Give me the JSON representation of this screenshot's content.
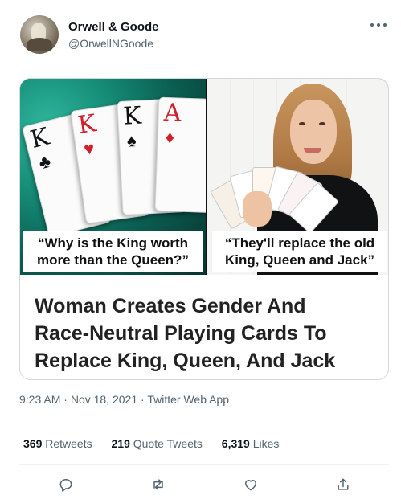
{
  "author": {
    "display_name": "Orwell & Goode",
    "handle": "@OrwellNGoode"
  },
  "media": {
    "left_caption_line1": "“Why is the King worth",
    "left_caption_line2": "more than the Queen?”",
    "right_caption_line1": "“They'll replace the old",
    "right_caption_line2": "King, Queen and Jack”",
    "cards": [
      {
        "rank": "K",
        "suit": "♣",
        "color": "#111111"
      },
      {
        "rank": "K",
        "suit": "♥",
        "color": "#d11f2b"
      },
      {
        "rank": "K",
        "suit": "♠",
        "color": "#111111"
      },
      {
        "rank": "A",
        "suit": "♦",
        "color": "#d11f2b"
      }
    ]
  },
  "card_headline": {
    "line1": "Woman Creates Gender And",
    "line2": "Race-Neutral Playing Cards To",
    "line3": "Replace King, Queen, And Jack"
  },
  "meta": {
    "time": "9:23 AM",
    "date": "Nov 18, 2021",
    "source": "Twitter Web App",
    "separator": "·"
  },
  "stats": {
    "retweets_count": "369",
    "retweets_label": "Retweets",
    "quote_count": "219",
    "quote_label": "Quote Tweets",
    "likes_count": "6,319",
    "likes_label": "Likes"
  },
  "actions": [
    "reply-icon",
    "retweet-icon",
    "like-icon",
    "share-icon"
  ],
  "colors": {
    "text_primary": "#0f1419",
    "text_secondary": "#536471",
    "border": "#cfd9de",
    "divider": "#eff3f4"
  }
}
